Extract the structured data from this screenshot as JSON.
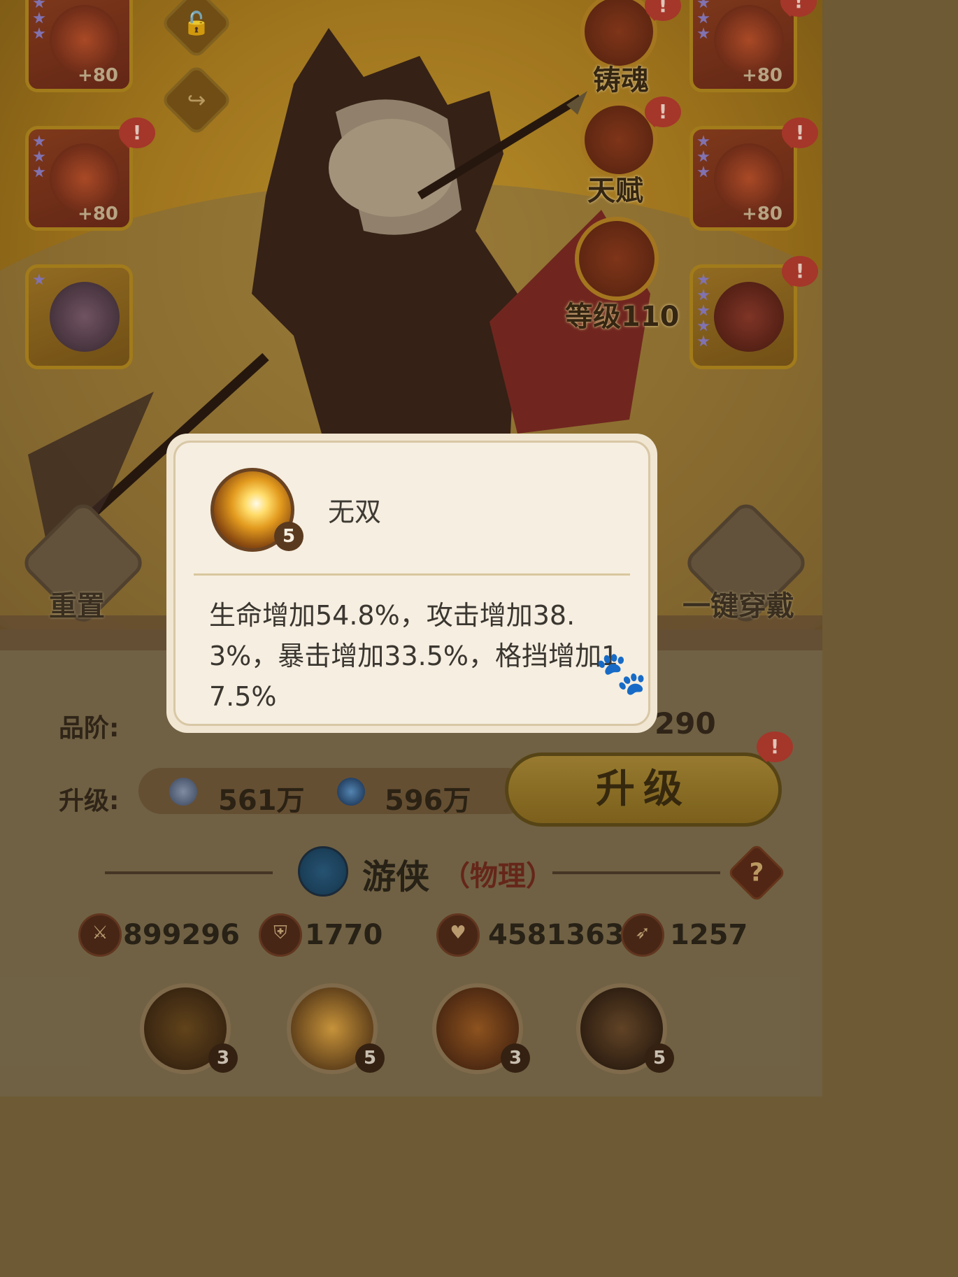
{
  "equipment_left": [
    {
      "plus": "+80",
      "alert": ""
    },
    {
      "plus": "+80",
      "alert": "!"
    },
    {
      "plus": "",
      "alert": ""
    }
  ],
  "equipment_right": [
    {
      "plus": "+80",
      "alert": "!"
    },
    {
      "plus": "+80",
      "alert": "!"
    },
    {
      "plus": "",
      "alert": "!"
    }
  ],
  "side_menu": {
    "soul_label": "铸魂",
    "talent_label": "天赋",
    "level_label": "等级110"
  },
  "actions": {
    "reset_label": "重置",
    "equip_all_label": "一键穿戴"
  },
  "quality": {
    "label": "品阶:",
    "value": "290"
  },
  "upgrade": {
    "label": "升级:",
    "silver": "561万",
    "orb": "596万",
    "button_label": "升级"
  },
  "hero_class": {
    "name": "游侠",
    "type": "（物理）",
    "help": "?"
  },
  "stats": {
    "attack": "899296",
    "defense": "1770",
    "hp": "45813633",
    "speed": "1257"
  },
  "skills": [
    {
      "level": "3"
    },
    {
      "level": "5"
    },
    {
      "level": "3"
    },
    {
      "level": "5"
    }
  ],
  "popup": {
    "title": "无双",
    "level": "5",
    "description": "生命增加54.8%，攻击增加38.3%，暴击增加33.5%，格挡增加17.5%"
  },
  "colors": {
    "accent_gold": "#b0861e",
    "alert_red": "#b33b2e",
    "popup_bg": "#f1e6d2"
  }
}
